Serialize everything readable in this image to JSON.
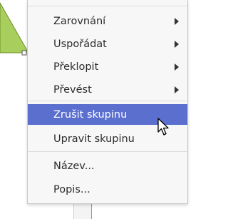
{
  "menu": {
    "groups": [
      [
        {
          "label": "Zarovnání",
          "submenu": true
        },
        {
          "label": "Uspořádat",
          "submenu": true
        },
        {
          "label": "Překlopit",
          "submenu": true
        },
        {
          "label": "Převést",
          "submenu": true
        }
      ],
      [
        {
          "label": "Zrušit skupinu",
          "submenu": false,
          "highlighted": true
        },
        {
          "label": "Upravit skupinu",
          "submenu": false
        }
      ],
      [
        {
          "label": "Název...",
          "submenu": false
        },
        {
          "label": "Popis...",
          "submenu": false
        }
      ]
    ]
  },
  "colors": {
    "highlight": "#5b6fcf",
    "shape_fill": "#a8cf5e"
  },
  "icons": {
    "pointer": "arrow-cursor-icon"
  }
}
